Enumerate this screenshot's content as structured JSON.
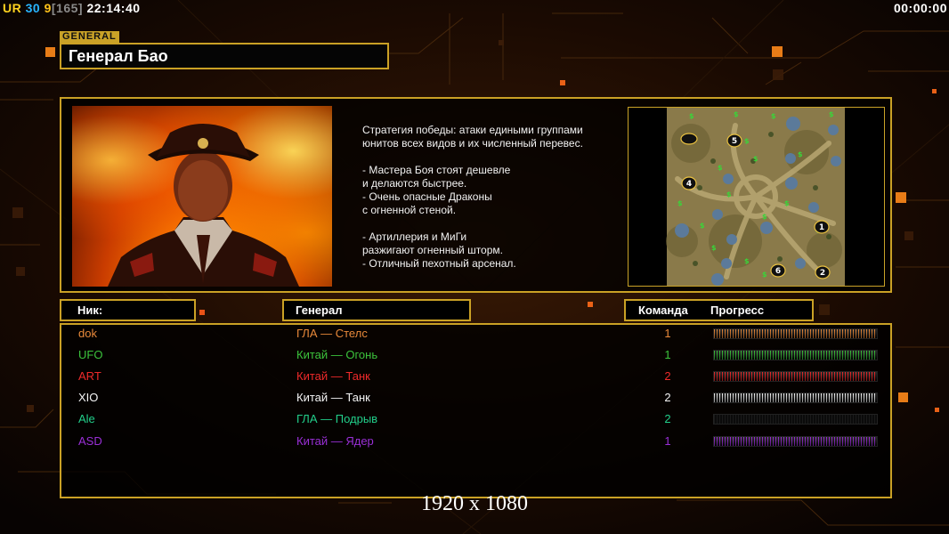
{
  "hud": {
    "ur": "UR",
    "num1": "30",
    "num2": "9",
    "bracket": "[165]",
    "clock": "22:14:40",
    "timer": "00:00:00"
  },
  "general_tag": "GENERAL",
  "general_name": "Генерал Бао",
  "description": [
    "Стратегия победы: атаки едиными группами",
    "юнитов всех видов и их численный перевес.",
    "",
    "- Мастера Боя стоят дешевле",
    "и делаются быстрее.",
    "- Очень опасные Драконы",
    "с огненной стеной.",
    "",
    "- Артиллерия и МиГи",
    "разжигают огненный шторм.",
    "- Отличный пехотный арсенал."
  ],
  "columns": {
    "nick": "Ник:",
    "general": "Генерал",
    "team": "Команда",
    "progress": "Прогресс"
  },
  "players": [
    {
      "nick": "dok",
      "general": "ГЛА — Стелс",
      "team": "1",
      "color": "#e8893a",
      "progress": 1.0
    },
    {
      "nick": "UFO",
      "general": "Китай — Огонь",
      "team": "1",
      "color": "#3cc43c",
      "progress": 1.0
    },
    {
      "nick": "ART",
      "general": "Китай — Танк",
      "team": "2",
      "color": "#ee2a2a",
      "progress": 1.0
    },
    {
      "nick": "XIO",
      "general": "Китай — Танк",
      "team": "2",
      "color": "#f4f4f4",
      "progress": 1.0
    },
    {
      "nick": "Ale",
      "general": "ГЛА — Подрыв",
      "team": "2",
      "color": "#22cf8a",
      "progress": 0.0
    },
    {
      "nick": "ASD",
      "general": "Китай — Ядер",
      "team": "1",
      "color": "#9a2fd6",
      "progress": 1.0
    }
  ],
  "map_spawns": [
    "5",
    "4",
    "1",
    "6",
    "2"
  ],
  "resolution": "1920 x 1080",
  "colors": {
    "accent": "#caa125",
    "hud_ur": "#ffd21f",
    "hud_num1": "#28b4ff",
    "hud_num2": "#ffc21a"
  }
}
